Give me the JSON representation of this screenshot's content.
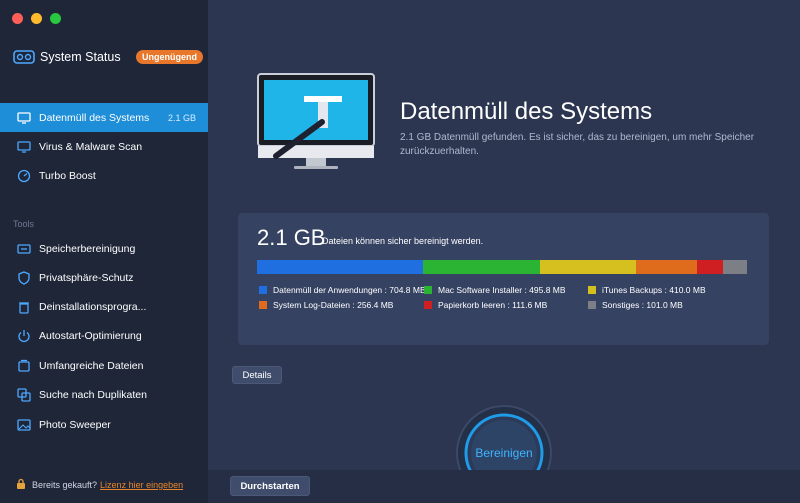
{
  "sidebar": {
    "status_title": "System Status",
    "status_badge": "Ungenügend",
    "items": [
      {
        "label": "Datenmüll des Systems",
        "meta": "2.1 GB"
      },
      {
        "label": "Virus & Malware Scan"
      },
      {
        "label": "Turbo Boost"
      }
    ],
    "tools_label": "Tools",
    "tools": [
      {
        "label": "Speicherbereinigung"
      },
      {
        "label": "Privatsphäre-Schutz"
      },
      {
        "label": "Deinstallationsprogra..."
      },
      {
        "label": "Autostart-Optimierung"
      },
      {
        "label": "Umfangreiche Dateien"
      },
      {
        "label": "Suche nach Duplikaten"
      },
      {
        "label": "Photo Sweeper"
      }
    ],
    "license_text": "Bereits gekauft?",
    "license_link": "Lizenz hier eingeben"
  },
  "main": {
    "title": "Datenmüll des Systems",
    "subtitle": "2.1 GB Datenmüll gefunden.  Es ist sicher, das zu bereinigen, um mehr Speicher zurückzuerhalten.",
    "size": "2.1 GB",
    "size_sub": "Dateien können sicher bereinigt werden.",
    "breakdown": [
      {
        "label": "Datenmüll der Anwendungen : 704.8 MB",
        "mb": 704.8,
        "color": "#1f6fe0"
      },
      {
        "label": "Mac Software Installer : 495.8 MB",
        "mb": 495.8,
        "color": "#2bb334"
      },
      {
        "label": "iTunes Backups : 410.0 MB",
        "mb": 410.0,
        "color": "#d6c01f"
      },
      {
        "label": "System Log-Dateien : 256.4 MB",
        "mb": 256.4,
        "color": "#df6c1d"
      },
      {
        "label": "Papierkorb leeren : 111.6 MB",
        "mb": 111.6,
        "color": "#d01f22"
      },
      {
        "label": "Sonstiges : 101.0 MB",
        "mb": 101.0,
        "color": "#7d7f86"
      }
    ],
    "details_label": "Details",
    "clean_label": "Bereinigen",
    "start_label": "Durchstarten"
  }
}
